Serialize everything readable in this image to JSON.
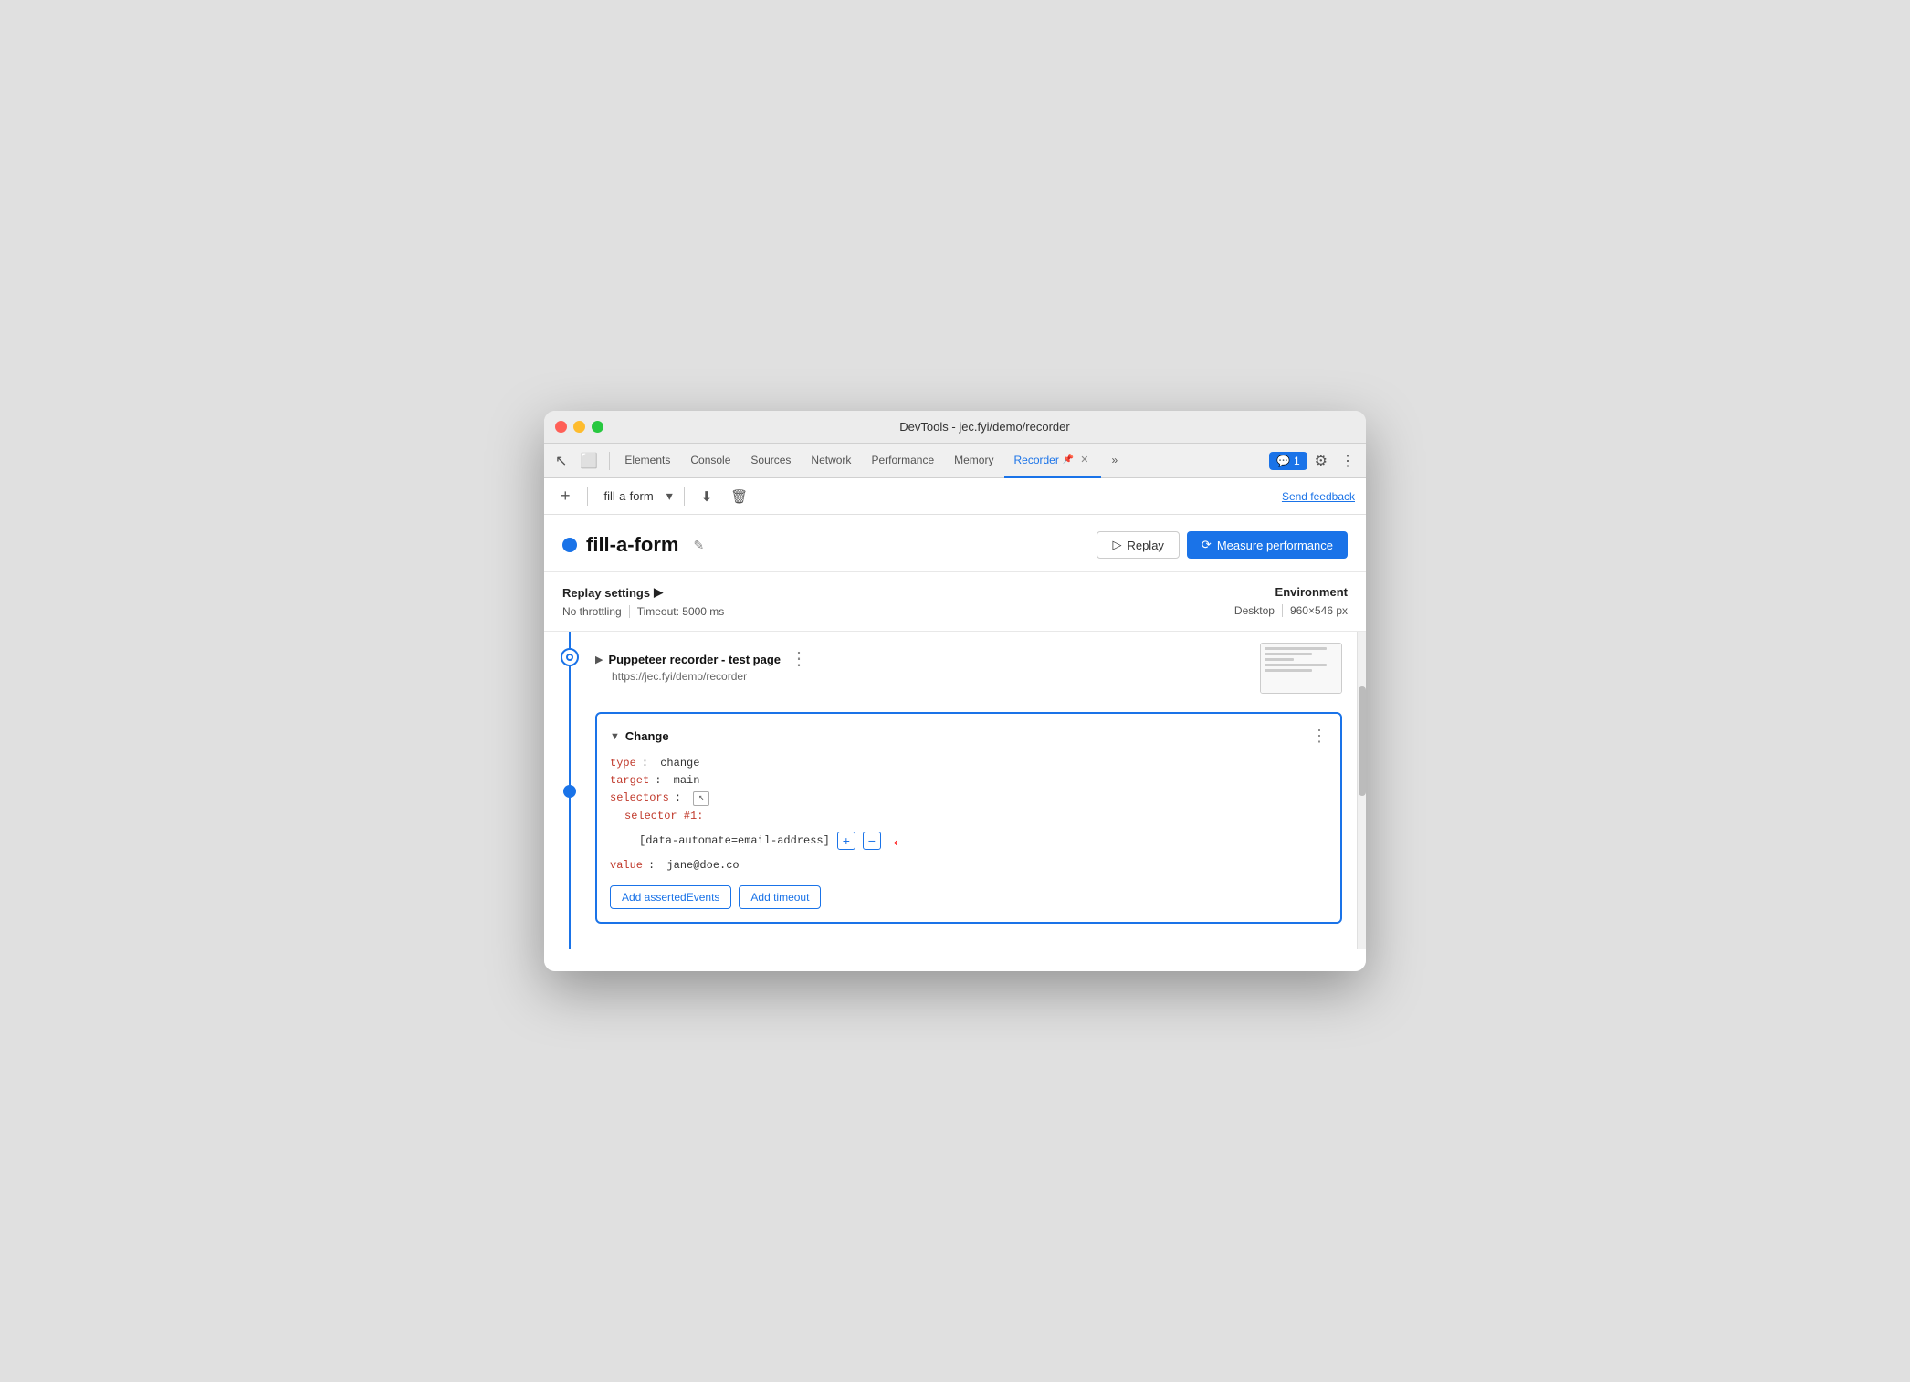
{
  "window": {
    "title": "DevTools - jec.fyi/demo/recorder"
  },
  "tabs": {
    "elements": "Elements",
    "console": "Console",
    "sources": "Sources",
    "network": "Network",
    "performance": "Performance",
    "memory": "Memory",
    "recorder": "Recorder",
    "more": "»",
    "chat_count": "1",
    "close_x": "✕"
  },
  "toolbar": {
    "add_icon": "+",
    "recording_name": "fill-a-form",
    "dropdown_icon": "▾",
    "download_icon": "⬇",
    "delete_icon": "🗑",
    "send_feedback": "Send feedback"
  },
  "recording": {
    "name": "fill-a-form",
    "dot_color": "#1a73e8",
    "replay_label": "Replay",
    "measure_label": "Measure performance"
  },
  "settings": {
    "title": "Replay settings",
    "expand_icon": "▶",
    "throttling": "No throttling",
    "timeout": "Timeout: 5000 ms",
    "env_title": "Environment",
    "env_type": "Desktop",
    "env_size": "960×546 px"
  },
  "steps": {
    "puppeteer": {
      "title": "Puppeteer recorder - test page",
      "url": "https://jec.fyi/demo/recorder"
    },
    "change": {
      "title": "Change",
      "type_key": "type",
      "type_val": "change",
      "target_key": "target",
      "target_val": "main",
      "selectors_key": "selectors",
      "selector_num_key": "selector #1:",
      "selector_val": "[data-automate=email-address]",
      "value_key": "value",
      "value_val": "jane@doe.co",
      "add_events_btn": "Add assertedEvents",
      "add_timeout_btn": "Add timeout"
    }
  },
  "icons": {
    "cursor": "↖",
    "dock": "⬛",
    "pencil": "✎",
    "play": "▷",
    "timer": "⟳",
    "chat": "💬",
    "gear": "⚙",
    "kebab": "⋮",
    "selector": "↖",
    "plus": "+",
    "minus": "−"
  }
}
